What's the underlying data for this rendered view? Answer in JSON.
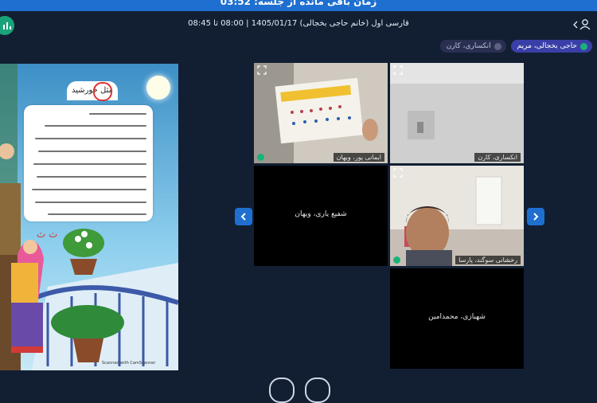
{
  "banner": {
    "text": "زمان باقی مانده از جلسه: 03:52"
  },
  "header": {
    "title": "فارسی اول (خانم حاجی بخجالی) 1405/01/17 | 08:00 تا 08:45"
  },
  "chips": [
    {
      "label": "حاجی بخجالی، مریم"
    },
    {
      "label": "انکساری، کارن"
    }
  ],
  "book": {
    "title": "مثل خورشید",
    "scanner_note": "Scanned with CamScanner"
  },
  "tiles": [
    {
      "name": "ایمانی پور، ویهان",
      "has_video": true
    },
    {
      "name": "انکساری، کارن",
      "has_video": true
    },
    {
      "name": "شفیع یاری، ویهان",
      "has_video": false
    },
    {
      "name": "رخشانی سوگند، پارسا",
      "has_video": true
    },
    {
      "name": "شهبازی، محمدامین",
      "has_video": false
    }
  ],
  "colors": {
    "accent": "#1f6fd1",
    "background": "#121f33",
    "online": "#19b27b"
  },
  "icons": [
    "user-icon",
    "stats-icon",
    "expand-icon",
    "mic-icon",
    "chevron-left-icon",
    "chevron-right-icon"
  ]
}
